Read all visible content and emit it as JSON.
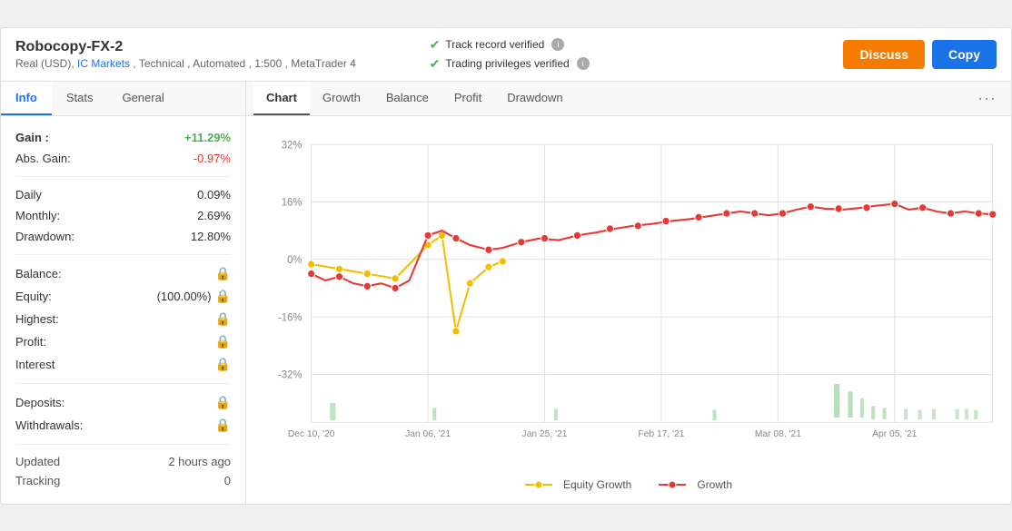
{
  "header": {
    "title": "Robocopy-FX-2",
    "subtitle": "Real (USD), IC Markets , Technical , Automated , 1:500 , MetaTrader 4",
    "ic_markets_link": "IC Markets",
    "track_record": "Track record verified",
    "trading_privileges": "Trading privileges verified",
    "discuss_label": "Discuss",
    "copy_label": "Copy"
  },
  "left_tabs": [
    {
      "label": "Info",
      "active": true
    },
    {
      "label": "Stats",
      "active": false
    },
    {
      "label": "General",
      "active": false
    }
  ],
  "stats": {
    "gain_label": "Gain :",
    "gain_value": "+11.29%",
    "abs_gain_label": "Abs. Gain:",
    "abs_gain_value": "-0.97%",
    "daily_label": "Daily",
    "daily_value": "0.09%",
    "monthly_label": "Monthly:",
    "monthly_value": "2.69%",
    "drawdown_label": "Drawdown:",
    "drawdown_value": "12.80%",
    "balance_label": "Balance:",
    "equity_label": "Equity:",
    "equity_value": "(100.00%)",
    "highest_label": "Highest:",
    "profit_label": "Profit:",
    "interest_label": "Interest",
    "deposits_label": "Deposits:",
    "withdrawals_label": "Withdrawals:",
    "updated_label": "Updated",
    "updated_value": "2 hours ago",
    "tracking_label": "Tracking",
    "tracking_value": "0"
  },
  "chart_tabs": [
    {
      "label": "Chart",
      "active": true
    },
    {
      "label": "Growth",
      "active": false
    },
    {
      "label": "Balance",
      "active": false
    },
    {
      "label": "Profit",
      "active": false
    },
    {
      "label": "Drawdown",
      "active": false
    }
  ],
  "chart": {
    "y_labels": [
      "32%",
      "16%",
      "0%",
      "-16%",
      "-32%"
    ],
    "x_labels": [
      "Dec 10, '20",
      "Jan 06, '21",
      "Jan 25, '21",
      "Feb 17, '21",
      "Mar 08, '21",
      "Apr 05, '21"
    ]
  },
  "legend": {
    "equity_growth": "Equity Growth",
    "growth": "Growth"
  }
}
